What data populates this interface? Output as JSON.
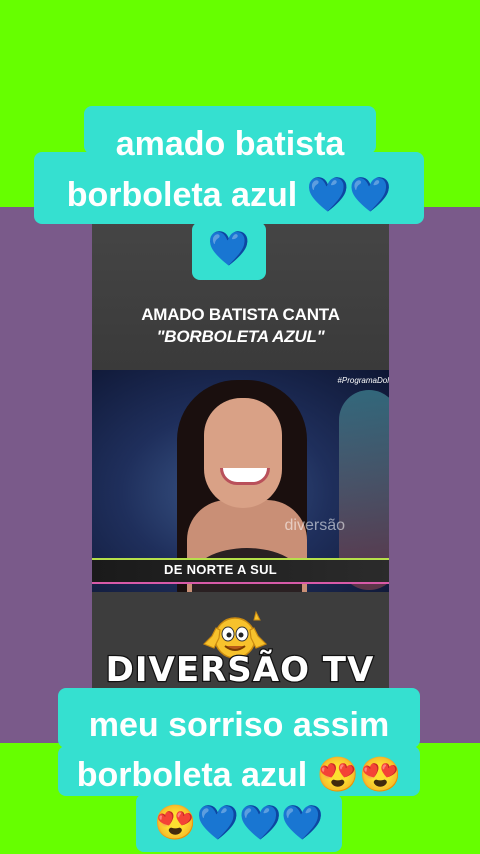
{
  "top_caption": {
    "line1": "amado batista",
    "line2": "borboleta azul 💙💙",
    "line3": "💙"
  },
  "video": {
    "heading_line1": "AMADO BATISTA CANTA",
    "heading_line2": "\"BORBOLETA AZUL\"",
    "hashtag": "#ProgramaDol",
    "watermark": "diversão",
    "lower_third": "DE NORTE A SUL"
  },
  "brand": {
    "label": "DIVERSÃO TV",
    "mascot_icon": "thumbs-up-emoji-icon"
  },
  "bottom_caption": {
    "line1": "meu sorriso assim",
    "line2": "borboleta azul 😍😍",
    "line3": "😍💙💙💙"
  },
  "colors": {
    "background": "#66ff00",
    "band": "#7a5a8a",
    "caption_box": "#35e0d0"
  }
}
